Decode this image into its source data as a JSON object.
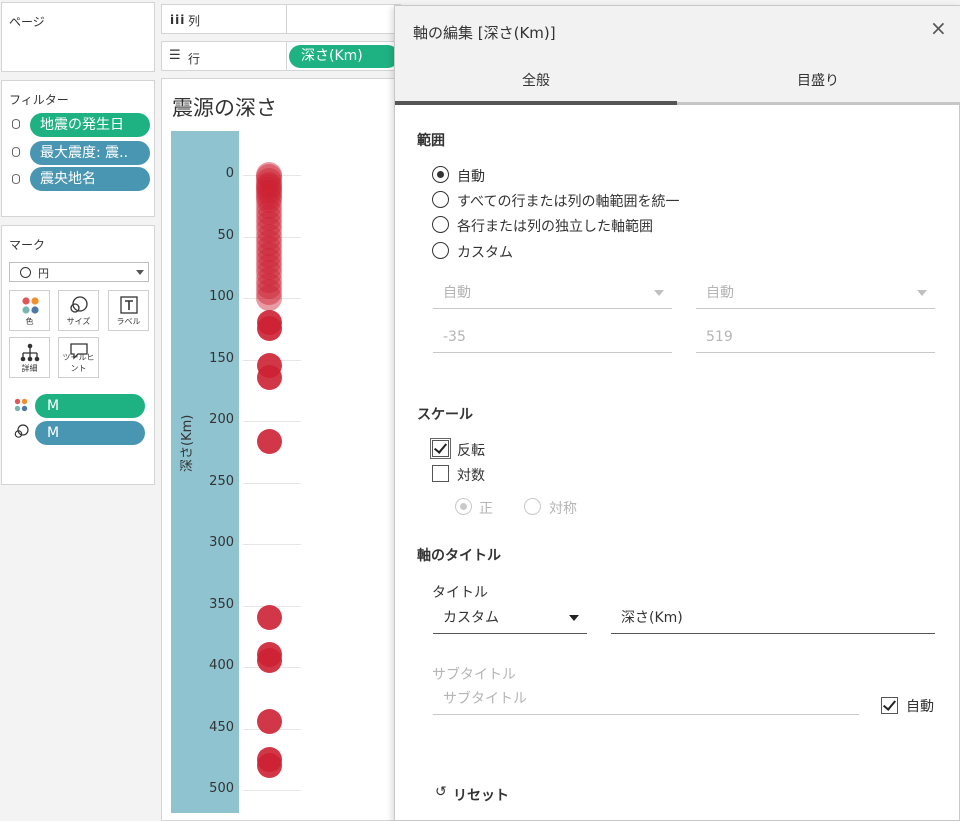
{
  "left_panel": {
    "pages_title": "ページ",
    "filters_title": "フィルター",
    "filters": [
      {
        "label": "地震の発生日",
        "color": "#1eb282"
      },
      {
        "label": "最大震度: 震..",
        "color": "#4996b2"
      },
      {
        "label": "震央地名",
        "color": "#4996b2"
      }
    ],
    "marks_title": "マーク",
    "mark_type": "円",
    "mark_buttons": {
      "color": "色",
      "size": "サイズ",
      "label": "ラベル",
      "detail": "詳細",
      "tooltip": "ツールヒント"
    },
    "mark_pills": [
      {
        "label": "M",
        "encoding": "color",
        "color": "#1eb282"
      },
      {
        "label": "M",
        "encoding": "size",
        "color": "#4996b2"
      }
    ]
  },
  "shelves": {
    "columns_label": "列",
    "rows_label": "行",
    "rows_pill": "深さ(Km)"
  },
  "chart": {
    "title": "震源の深さ"
  },
  "chart_data": {
    "type": "scatter",
    "title": "震源の深さ",
    "ylabel": "深さ(Km)",
    "reversed": true,
    "ylim": [
      0,
      500
    ],
    "yticks": [
      "0",
      "50",
      "100",
      "150",
      "200",
      "250",
      "300",
      "350",
      "400",
      "450",
      "500"
    ],
    "y": [
      0,
      2,
      5,
      8,
      10,
      12,
      15,
      18,
      20,
      25,
      30,
      35,
      40,
      45,
      50,
      55,
      60,
      65,
      70,
      75,
      80,
      85,
      90,
      95,
      100,
      120,
      125,
      155,
      165,
      217,
      360,
      390,
      395,
      444,
      475,
      480
    ],
    "series_color": "#cc2133"
  },
  "dialog": {
    "title": "軸の編集 [深さ(Km)]",
    "tabs": [
      "全般",
      "目盛り"
    ],
    "range_section": "範囲",
    "range_options": [
      "自動",
      "すべての行または列の軸範囲を統一",
      "各行または列の独立した軸範囲",
      "カスタム"
    ],
    "range_selected": 0,
    "range_min_mode": "自動",
    "range_max_mode": "自動",
    "range_min_value": "-35",
    "range_max_value": "519",
    "scale_section": "スケール",
    "reversed_label": "反転",
    "reversed_checked": true,
    "log_label": "対数",
    "log_checked": false,
    "positive_label": "正",
    "symmetric_label": "対称",
    "axis_title_section": "軸のタイトル",
    "title_label": "タイトル",
    "title_mode": "カスタム",
    "title_value": "深さ(Km)",
    "subtitle_label": "サブタイトル",
    "subtitle_placeholder": "サブタイトル",
    "subtitle_auto_label": "自動",
    "subtitle_auto_checked": true,
    "reset_label": "リセット"
  }
}
